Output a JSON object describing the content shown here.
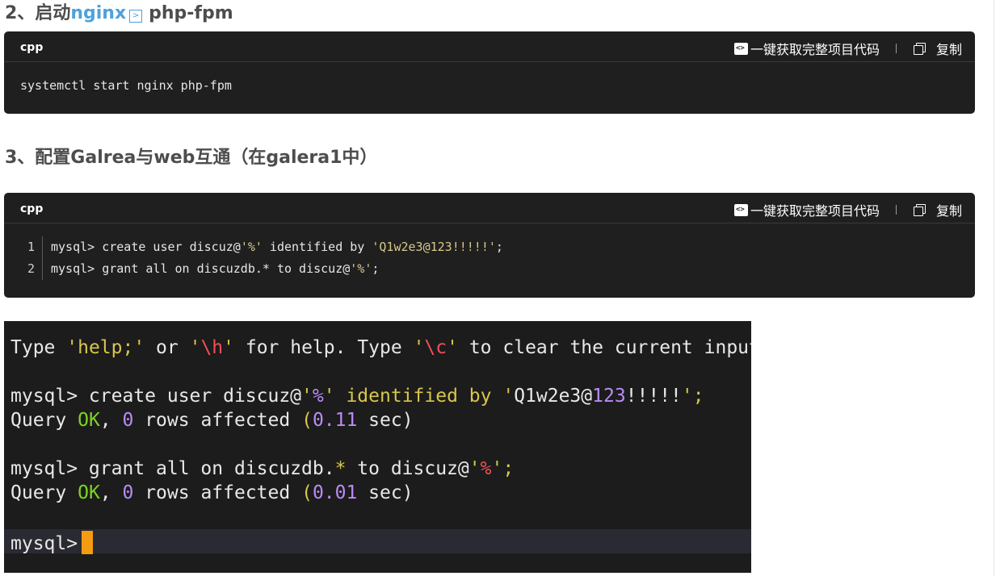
{
  "section2": {
    "number": "2、",
    "prefix": "启动",
    "link": "nginx",
    "icon": "terminal-icon",
    "suffix": "php-fpm"
  },
  "block1": {
    "lang": "cpp",
    "project_label": "一键获取完整项目代码",
    "copy_label": "复制",
    "code": "systemctl start nginx php-fpm"
  },
  "section3": {
    "title": "3、配置Galrea与web互通（在galera1中）"
  },
  "block2": {
    "lang": "cpp",
    "project_label": "一键获取完整项目代码",
    "copy_label": "复制",
    "lines": [
      {
        "num": "1",
        "pre": "mysql> create user discuz@",
        "s1": "'%'",
        "mid": " identified by ",
        "s2": "'Q1w2e3@123!!!!!'",
        "post": ";"
      },
      {
        "num": "2",
        "pre": "mysql> grant all on discuzdb.* to discuz@",
        "s1": "'%'",
        "post": ";"
      }
    ]
  },
  "terminal": {
    "help": {
      "a": "Type ",
      "b": "'help;'",
      "c": " or ",
      "d1": "'",
      "d2": "\\h",
      "d3": "'",
      "e": " for help. Type ",
      "f1": "'",
      "f2": "\\c",
      "f3": "'",
      "g": " to clear the current input"
    },
    "cmd1": {
      "a": "mysql> create user discuz@",
      "b1": "'",
      "b2": "%",
      "b3": "'",
      "c": " identified by ",
      "d1": "'",
      "d2": "Q1w2e3@",
      "d3": "123",
      "d4": "!!!!!",
      "d5": "'",
      "e": ";"
    },
    "res1": {
      "a": "Query ",
      "b": "OK",
      "c": ", ",
      "d": "0",
      "e": " rows affected ",
      "f": "(",
      "g": "0.11",
      "h": " sec)"
    },
    "cmd2": {
      "a": "mysql> grant all on discuzdb.",
      "b": "*",
      "c": " to discuz@",
      "d1": "'",
      "d2": "%",
      "d3": "'",
      "e": ";"
    },
    "res2": {
      "a": "Query ",
      "b": "OK",
      "c": ", ",
      "d": "0",
      "e": " rows affected ",
      "f": "(",
      "g": "0.01",
      "h": " sec)"
    },
    "prompt": "mysql>",
    "colors": {
      "string": "#d8c64a",
      "escape": "#f0505a",
      "number": "#b98cf5",
      "ok": "#7ed321",
      "cursor": "#f39c12"
    }
  }
}
